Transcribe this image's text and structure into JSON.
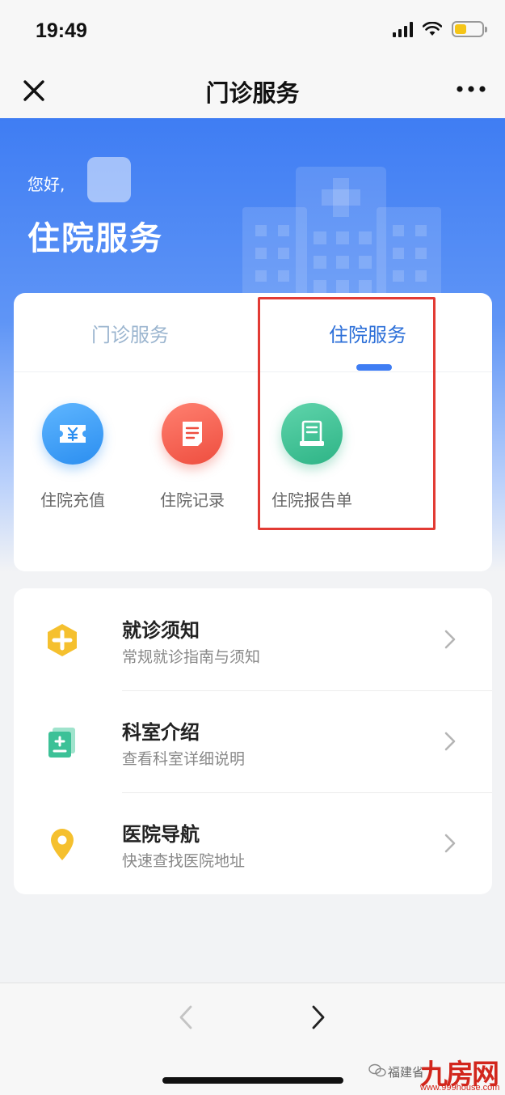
{
  "status_bar": {
    "time": "19:49",
    "battery_level": 0.45
  },
  "nav": {
    "title": "门诊服务"
  },
  "hero": {
    "greeting": "您好,",
    "title": "住院服务"
  },
  "tabs": [
    {
      "label": "门诊服务",
      "active": false
    },
    {
      "label": "住院服务",
      "active": true
    }
  ],
  "services": [
    {
      "label": "住院充值",
      "icon": "yen-ticket-icon",
      "color": "#2b8ef0"
    },
    {
      "label": "住院记录",
      "icon": "document-icon",
      "color": "#ee4e3f"
    },
    {
      "label": "住院报告单",
      "icon": "report-icon",
      "color": "#2eb486"
    }
  ],
  "info_items": [
    {
      "title": "就诊须知",
      "desc": "常规就诊指南与须知",
      "icon": "medical-cross-icon",
      "color": "#f5c02e"
    },
    {
      "title": "科室介绍",
      "desc": "查看科室详细说明",
      "icon": "department-doc-icon",
      "color": "#3cc197"
    },
    {
      "title": "医院导航",
      "desc": "快速查找医院地址",
      "icon": "location-pin-icon",
      "color": "#f5c02e"
    }
  ],
  "watermark": {
    "text": "福建省",
    "logo": "九房网",
    "url": "www.999house.com"
  },
  "colors": {
    "primary": "#3f7df3",
    "highlight_box": "#e23b34"
  }
}
